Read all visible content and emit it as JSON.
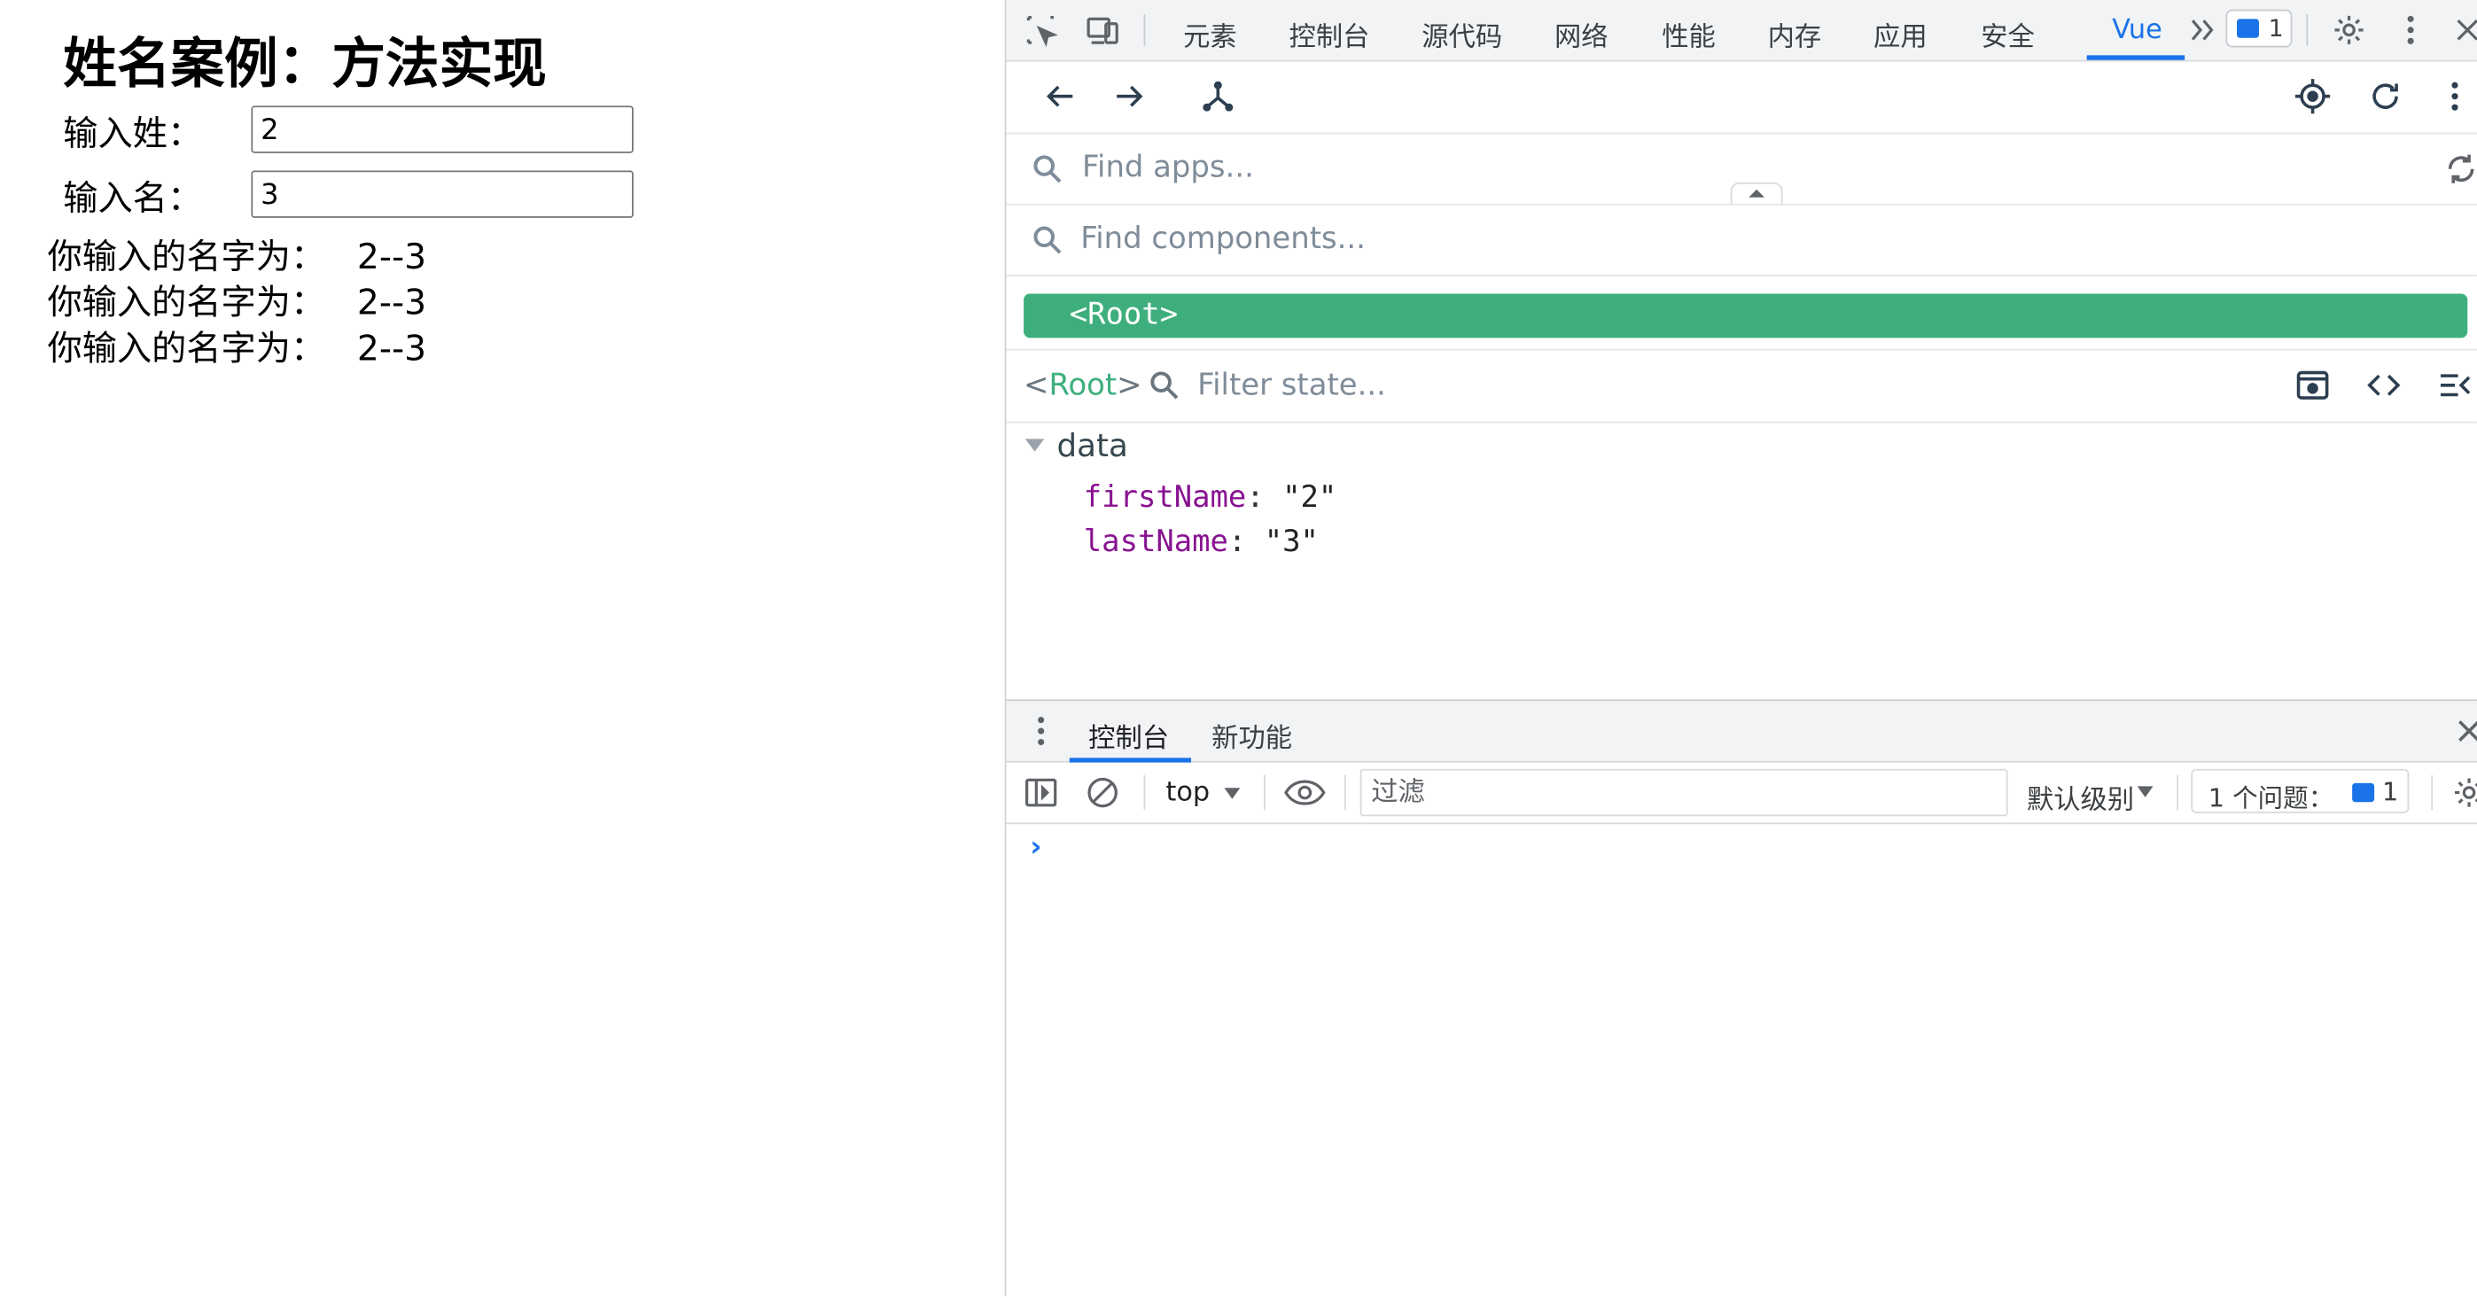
{
  "page": {
    "title": "姓名案例：方法实现",
    "first_label": "输入姓：",
    "first_value": "2",
    "last_label": "输入名：",
    "last_value": "3",
    "results": [
      {
        "label": "你输入的名字为：",
        "value": "2--3"
      },
      {
        "label": "你输入的名字为：",
        "value": "2--3"
      },
      {
        "label": "你输入的名字为：",
        "value": "2--3"
      }
    ]
  },
  "devtools": {
    "tabs": [
      {
        "label": "元素"
      },
      {
        "label": "控制台"
      },
      {
        "label": "源代码"
      },
      {
        "label": "网络"
      },
      {
        "label": "性能"
      },
      {
        "label": "内存"
      },
      {
        "label": "应用"
      },
      {
        "label": "安全"
      },
      {
        "label": "Vue"
      }
    ],
    "active_tab": "Vue",
    "issues_count": "1",
    "accent_color": "#1a73e8"
  },
  "vue": {
    "find_apps_placeholder": "Find apps...",
    "find_components_placeholder": "Find components...",
    "root_component": "<Root>",
    "selected_component": "Root",
    "filter_state_placeholder": "Filter state...",
    "section_title": "data",
    "props": [
      {
        "key": "firstName",
        "value": "\"2\""
      },
      {
        "key": "lastName",
        "value": "\"3\""
      }
    ],
    "accent_color": "#3eaf7c"
  },
  "drawer": {
    "tabs": [
      {
        "label": "控制台"
      },
      {
        "label": "新功能"
      }
    ],
    "context": "top",
    "filter_placeholder": "过滤",
    "level": "默认级别",
    "issues_label": "1 个问题：",
    "issues_count": "1",
    "prompt": "›"
  }
}
